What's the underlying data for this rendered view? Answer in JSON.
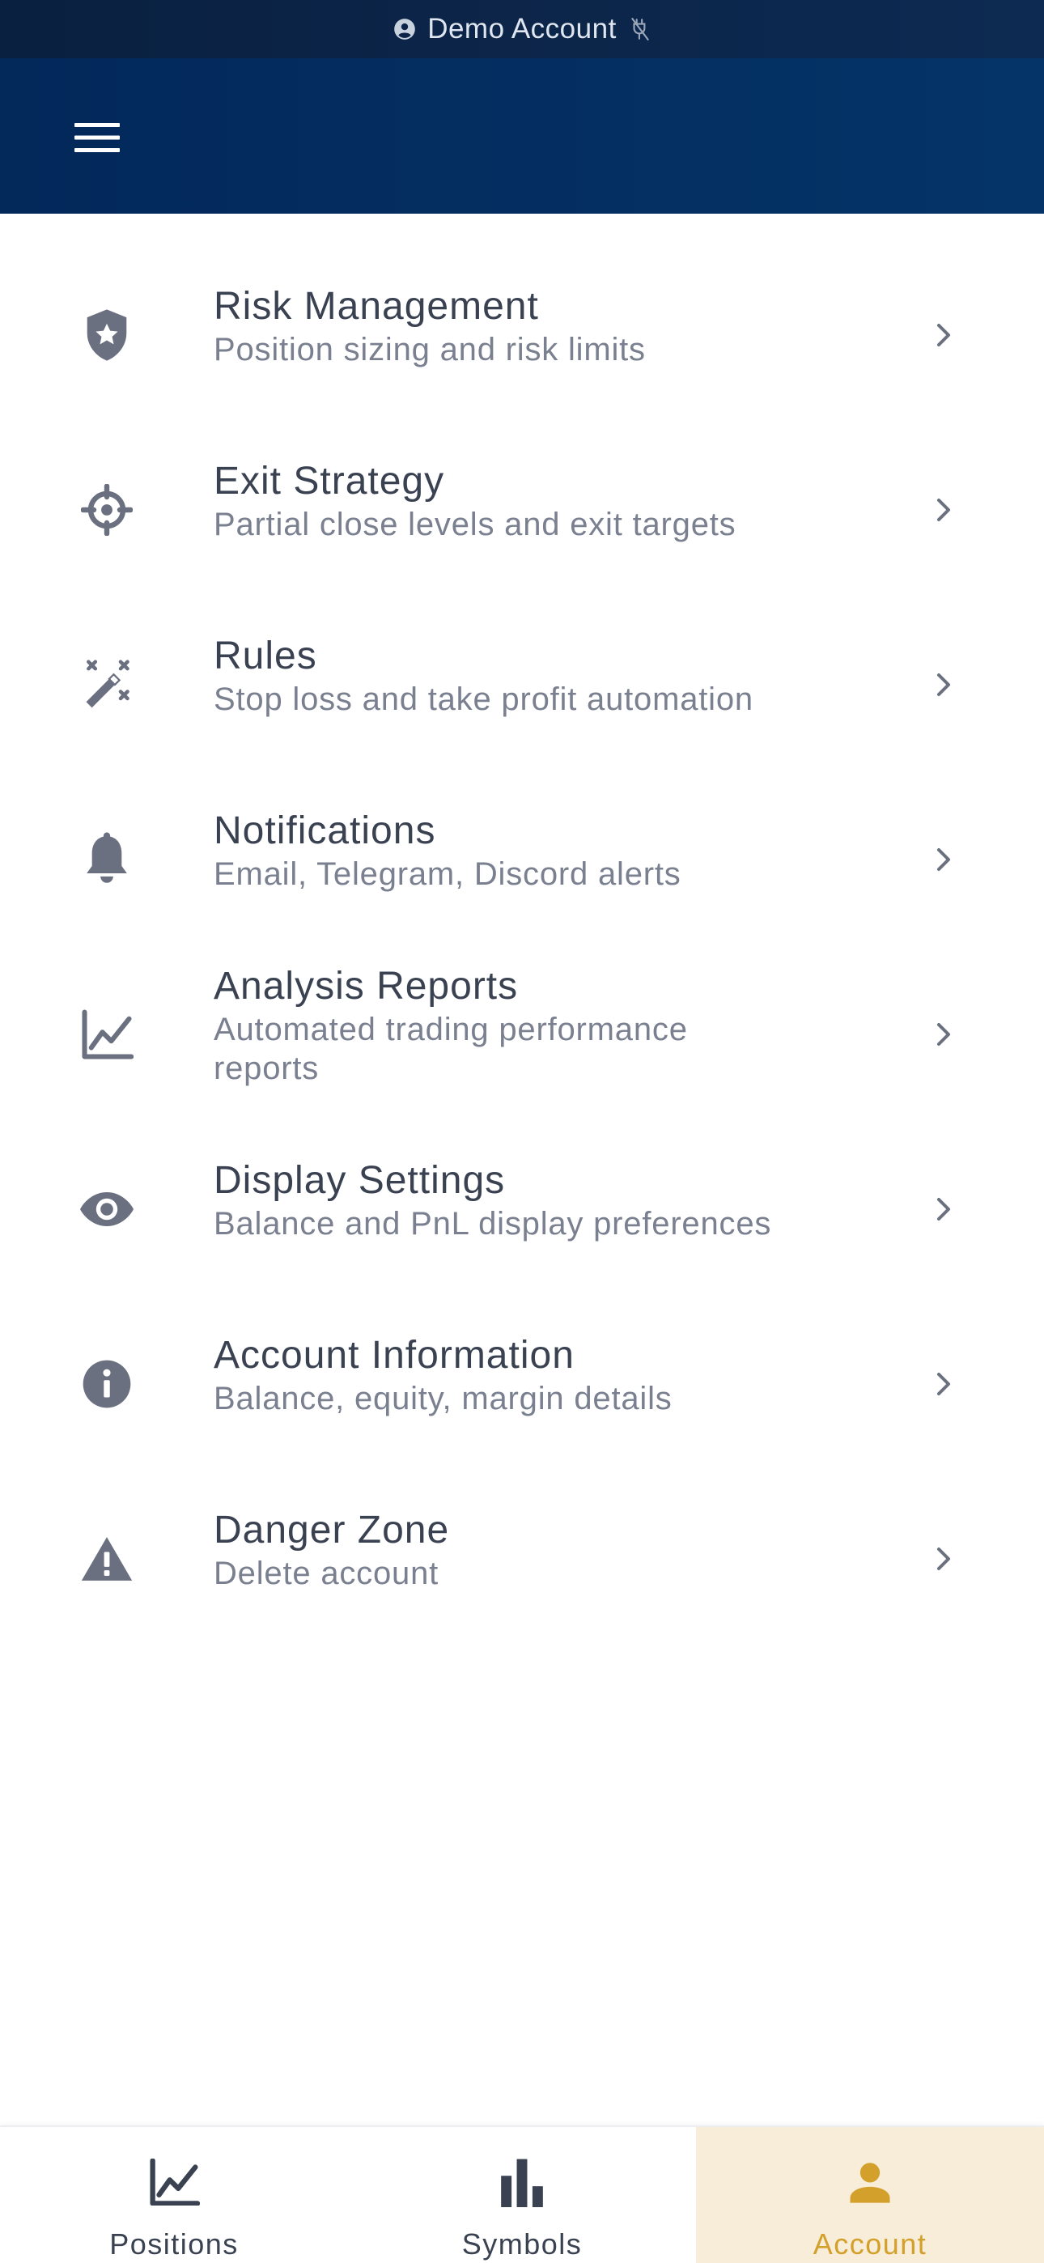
{
  "status_bar": {
    "account_label": "Demo Account",
    "left_icon": "account-circle-icon",
    "right_icon": "plug-disconnected-icon"
  },
  "app_bar": {
    "menu_icon": "hamburger-menu-icon"
  },
  "settings": {
    "items": [
      {
        "title": "Risk Management",
        "subtitle": "Position sizing and risk limits",
        "icon": "shield-star-icon"
      },
      {
        "title": "Exit Strategy",
        "subtitle": "Partial close levels and exit targets",
        "icon": "crosshair-icon"
      },
      {
        "title": "Rules",
        "subtitle": "Stop loss and take profit automation",
        "icon": "magic-wand-icon"
      },
      {
        "title": "Notifications",
        "subtitle": "Email, Telegram, Discord alerts",
        "icon": "bell-icon"
      },
      {
        "title": "Analysis Reports",
        "subtitle_line1": "Automated trading performance",
        "subtitle_line2": "reports",
        "icon": "line-chart-icon"
      },
      {
        "title": "Display Settings",
        "subtitle": "Balance and PnL display preferences",
        "icon": "eye-icon"
      },
      {
        "title": "Account Information",
        "subtitle": "Balance, equity, margin details",
        "icon": "info-icon"
      },
      {
        "title": "Danger Zone",
        "subtitle": "Delete account",
        "icon": "warning-icon"
      }
    ]
  },
  "bottom_nav": {
    "tabs": [
      {
        "label": "Positions",
        "icon": "line-chart-icon",
        "active": false
      },
      {
        "label": "Symbols",
        "icon": "bar-chart-icon",
        "active": false
      },
      {
        "label": "Account",
        "icon": "person-icon",
        "active": true
      }
    ]
  },
  "colors": {
    "app_bar": "#04305f",
    "status_bar": "#0b2447",
    "icon_gray": "#6b7080",
    "title_text": "#3a4252",
    "subtitle_text": "#7a8090",
    "accent": "#d4a02c",
    "active_tab_bg": "#f8edd8"
  }
}
